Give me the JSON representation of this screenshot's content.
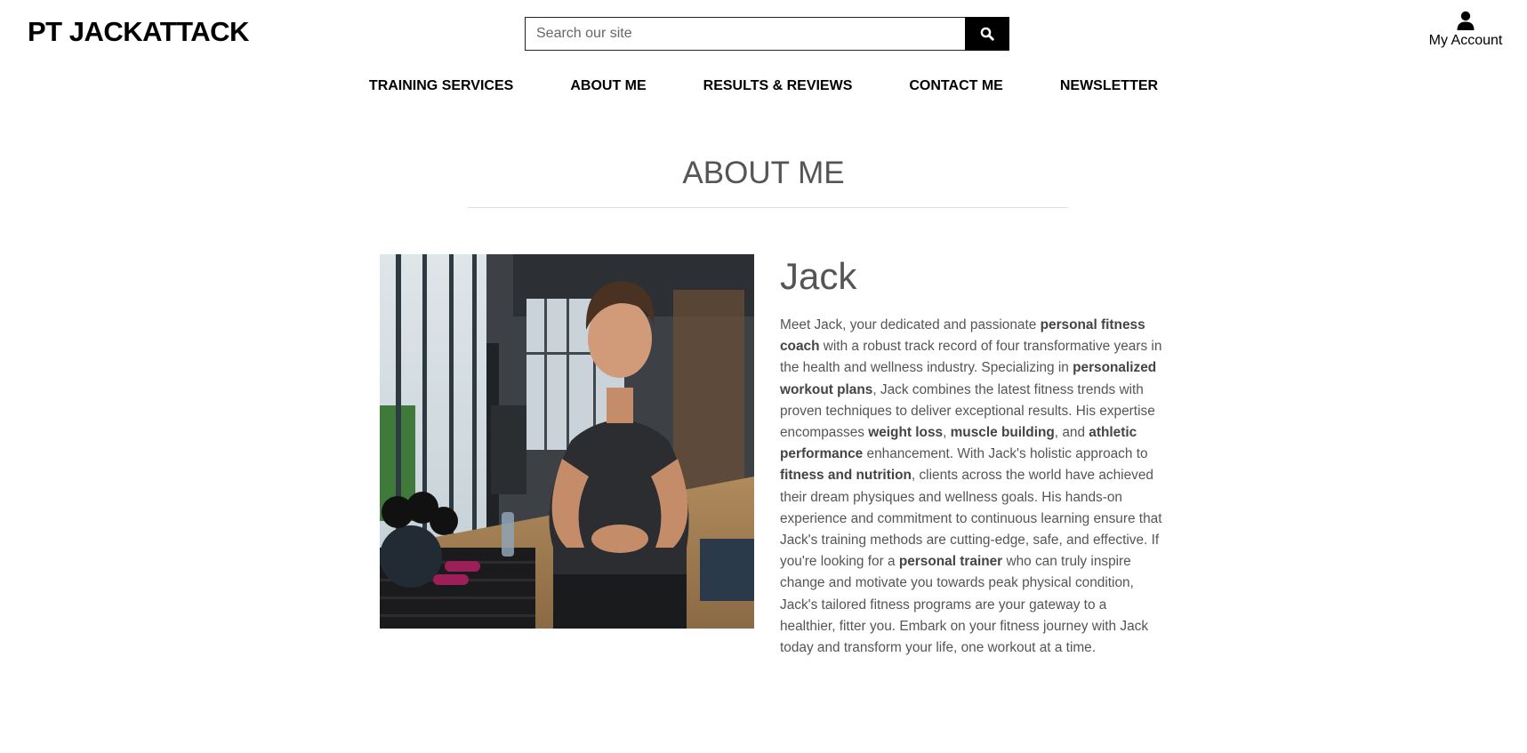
{
  "header": {
    "logo": "PT JACKATTACK",
    "search_placeholder": "Search our site",
    "account_label": "My Account"
  },
  "nav": {
    "items": [
      "TRAINING SERVICES",
      "ABOUT ME",
      "RESULTS & REVIEWS",
      "CONTACT ME",
      "NEWSLETTER"
    ]
  },
  "page": {
    "title": "ABOUT ME"
  },
  "bio": {
    "name": "Jack",
    "segments": [
      {
        "text": "Meet Jack, your dedicated and passionate ",
        "bold": false
      },
      {
        "text": "personal fitness coach",
        "bold": true
      },
      {
        "text": " with a robust track record of four transformative years in the health and wellness industry. Specializing in ",
        "bold": false
      },
      {
        "text": "personalized workout plans",
        "bold": true
      },
      {
        "text": ", Jack combines the latest fitness trends with proven techniques to deliver exceptional results. His expertise encompasses ",
        "bold": false
      },
      {
        "text": "weight loss",
        "bold": true
      },
      {
        "text": ", ",
        "bold": false
      },
      {
        "text": "muscle building",
        "bold": true
      },
      {
        "text": ", and ",
        "bold": false
      },
      {
        "text": "athletic performance",
        "bold": true
      },
      {
        "text": " enhancement. With Jack's holistic approach to ",
        "bold": false
      },
      {
        "text": "fitness and nutrition",
        "bold": true
      },
      {
        "text": ", clients across the world have achieved their dream physiques and wellness goals. His hands-on experience and commitment to continuous learning ensure that Jack's training methods are cutting-edge, safe, and effective. If you're looking for a ",
        "bold": false
      },
      {
        "text": "personal trainer",
        "bold": true
      },
      {
        "text": " who can truly inspire change and motivate you towards peak physical condition, Jack's tailored fitness programs are your gateway to a healthier, fitter you. Embark on your fitness journey with Jack today and transform your life, one workout at a time.",
        "bold": false
      }
    ]
  },
  "icons": {
    "search": "search-icon",
    "account": "user-icon"
  }
}
